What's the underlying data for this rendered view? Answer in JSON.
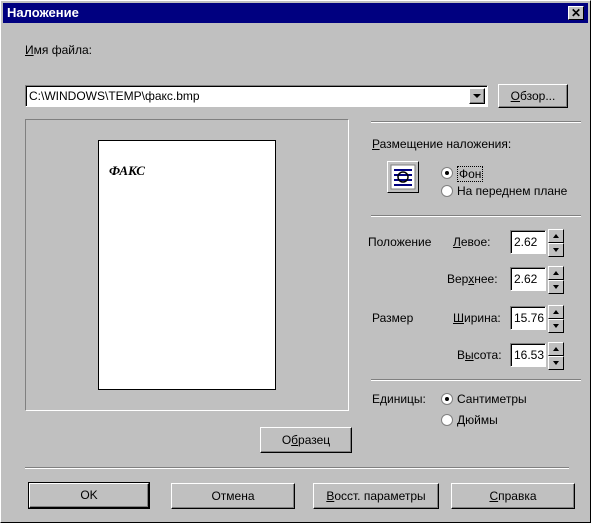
{
  "dialog": {
    "title": "Наложение",
    "close_icon": "close-icon"
  },
  "file": {
    "label_u": "И",
    "label_rest": "мя файла:",
    "value": "C:\\WINDOWS\\TEMP\\факс.bmp",
    "browse_u": "О",
    "browse_rest": "бзор..."
  },
  "preview": {
    "page_text": "ФАКС",
    "sample_pre": "О",
    "sample_u": "б",
    "sample_rest": "разец"
  },
  "placement": {
    "title_u": "Р",
    "title_rest": "азмещение наложения:",
    "icon": "background-placement-icon",
    "options": [
      {
        "label": "Фон",
        "selected": true
      },
      {
        "label": "На переднем плане",
        "selected": false
      }
    ]
  },
  "position": {
    "label": "Положение",
    "left_u": "Л",
    "left_rest": "евое:",
    "left_value": "2.62",
    "top_pre": "Вер",
    "top_u": "х",
    "top_rest": "нее:",
    "top_value": "2.62"
  },
  "size": {
    "label": "Размер",
    "width_u": "Ш",
    "width_rest": "ирина:",
    "width_value": "15.76",
    "height_pre": "В",
    "height_u": "ы",
    "height_rest": "сота:",
    "height_value": "16.53"
  },
  "units": {
    "label": "Единицы:",
    "options": [
      {
        "label": "Сантиметры",
        "selected": true
      },
      {
        "label": "Дюймы",
        "selected": false
      }
    ]
  },
  "buttons": {
    "ok": "OK",
    "cancel": "Отмена",
    "restore_u": "В",
    "restore_rest": "осст. параметры",
    "help_u": "С",
    "help_rest": "правка"
  }
}
